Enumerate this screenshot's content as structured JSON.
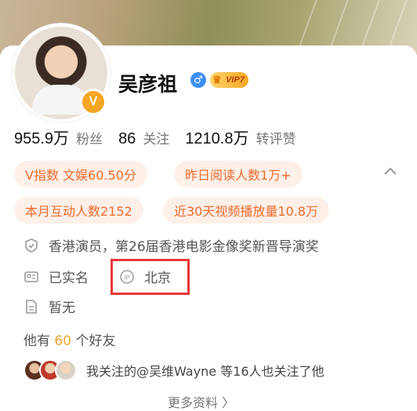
{
  "profile": {
    "name": "吴彦祖",
    "gender_symbol": "♂",
    "vip_label": "VIP7",
    "verified_mark": "V"
  },
  "stats": [
    {
      "value": "955.9万",
      "label": "粉丝"
    },
    {
      "value": "86",
      "label": "关注"
    },
    {
      "value": "1210.8万",
      "label": "转评赞"
    }
  ],
  "tags": [
    "V指数 文娱60.50分",
    "昨日阅读人数1万+",
    "本月互动人数2152",
    "近30天视频播放量10.8万"
  ],
  "info": {
    "bio": "香港演员，第26届香港电影金像奖新晋导演奖",
    "real_name_status": "已实名",
    "ip_location": "北京",
    "intro": "暂无"
  },
  "friends": {
    "prefix": "他有",
    "count": "60",
    "suffix": "个好友"
  },
  "mutual_follow": "我关注的@吴维Wayne 等16人也关注了他",
  "more_label": "更多资料 〉",
  "colors": {
    "accent_orange": "#ee6a2f",
    "tag_bg": "#fdf0e8",
    "highlight_red": "#e63838",
    "gender_blue": "#3d8ff5"
  }
}
